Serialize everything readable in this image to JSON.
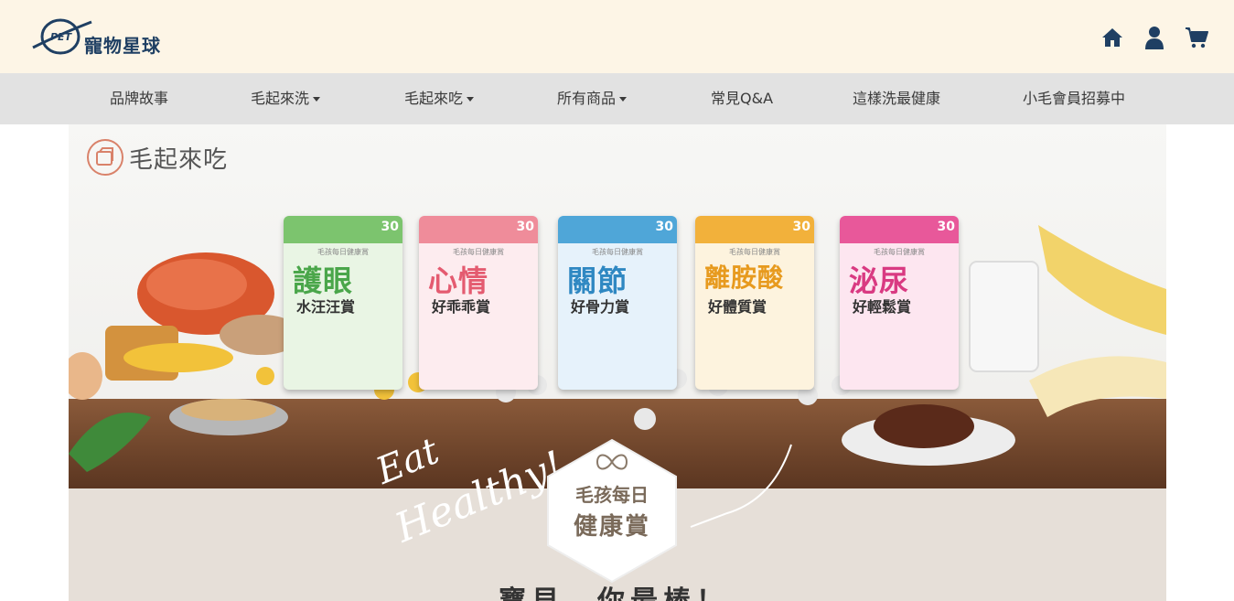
{
  "header": {
    "logo_badge": "PET",
    "logo_text": "寵物星球",
    "icons": [
      "home-icon",
      "user-icon",
      "cart-icon"
    ]
  },
  "nav": {
    "items": [
      {
        "label": "品牌故事",
        "dropdown": false
      },
      {
        "label": "毛起來洗",
        "dropdown": true
      },
      {
        "label": "毛起來吃",
        "dropdown": true
      },
      {
        "label": "所有商品",
        "dropdown": true
      },
      {
        "label": "常見Q&A",
        "dropdown": false
      },
      {
        "label": "這樣洗最健康",
        "dropdown": false
      },
      {
        "label": "小毛會員招募中",
        "dropdown": false
      }
    ]
  },
  "banner": {
    "brand": "毛起來吃",
    "eat": "Eat",
    "healthy": "Healthy!",
    "badge_line1": "毛孩每日",
    "badge_line2": "健康賞",
    "tagline": "寶貝，你最棒！",
    "packs": [
      {
        "title": "護眼",
        "subtitle": "水汪汪賞",
        "count": "30",
        "color": "#7cc46e"
      },
      {
        "title": "心情",
        "subtitle": "好乖乖賞",
        "count": "30",
        "color": "#ef8c9a"
      },
      {
        "title": "關節",
        "subtitle": "好骨力賞",
        "count": "30",
        "color": "#4fa6d8"
      },
      {
        "title": "離胺酸",
        "subtitle": "好體質賞",
        "count": "30",
        "color": "#f2b13b"
      },
      {
        "title": "泌尿",
        "subtitle": "好輕鬆賞",
        "count": "30",
        "color": "#e8589a"
      }
    ],
    "pack_line": "毛孩每日健康賞"
  },
  "colors": {
    "header_bg": "#fdf5e6",
    "nav_bg": "#e2e2e2",
    "brand_navy": "#1f3f63"
  }
}
